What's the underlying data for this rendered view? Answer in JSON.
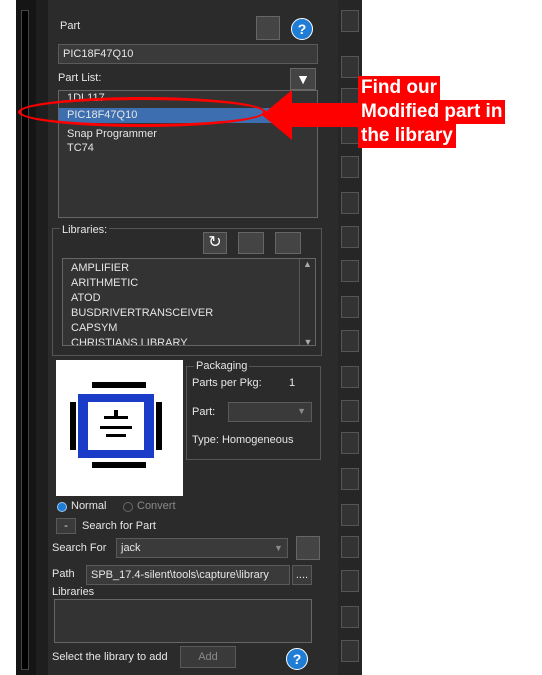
{
  "part_panel": {
    "part_label": "Part",
    "part_value": "PIC18F47Q10",
    "part_list_label": "Part List:",
    "part_list_items": [
      "1DL117",
      "PIC18F47Q10",
      "Snap Programmer",
      "TC74"
    ],
    "libraries_label": "Libraries:",
    "libraries_items": [
      "AMPLIFIER",
      "ARITHMETIC",
      "ATOD",
      "BUSDRIVERTRANSCEIVER",
      "CAPSYM",
      "CHRISTIANS LIBRARY"
    ],
    "packaging_label": "Packaging",
    "parts_per_pkg_label": "Parts per Pkg:",
    "parts_per_pkg_value": "1",
    "part_label2": "Part:",
    "type_label": "Type: Homogeneous",
    "normal_label": "Normal",
    "convert_label": "Convert",
    "search_toggle": "-",
    "search_for_part_label": "Search for Part",
    "search_for_label": "Search For",
    "search_for_value": "jack",
    "path_label": "Path",
    "path_value": "SPB_17.4-silent\\tools\\capture\\library",
    "path_browse": "....",
    "libraries_label2": "Libraries",
    "select_library_label": "Select the library to add",
    "add_button": "Add",
    "help_glyph": "?"
  },
  "annotation": {
    "callout_lines": [
      "Find our",
      "Modified part in",
      "the library"
    ]
  },
  "colors": {
    "panel_bg": "#2b2b2b",
    "highlight_red": "#ff0000",
    "selection": "#3d6fb0"
  }
}
